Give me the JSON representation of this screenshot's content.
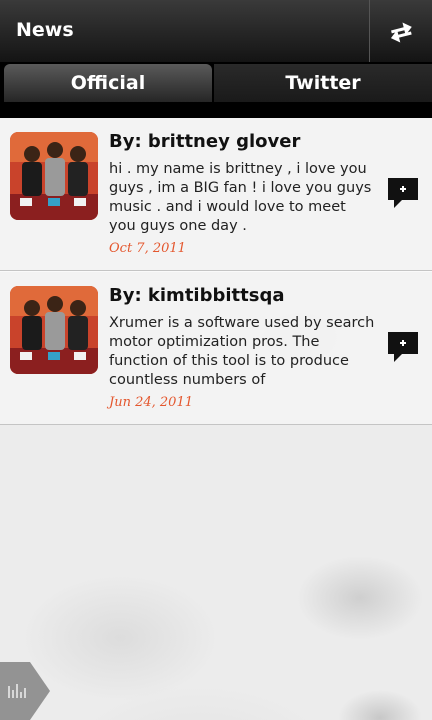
{
  "header": {
    "title": "News"
  },
  "tabs": [
    {
      "label": "Official",
      "active": true
    },
    {
      "label": "Twitter",
      "active": false
    }
  ],
  "posts": [
    {
      "author": "By: brittney glover",
      "text": "hi . my name is brittney , i love you guys , im a BIG fan ! i love you guys music . and i would love to meet you guys one day .",
      "date": "Oct 7, 2011"
    },
    {
      "author": "By: kimtibbittsqa",
      "text": "Xrumer is a software used by search motor optimization pros. The function of this tool is to produce countless numbers of",
      "date": "Jun 24, 2011"
    }
  ],
  "icons": {
    "refresh": "refresh-icon",
    "comment": "add-comment-icon",
    "equalizer": "equalizer-icon"
  },
  "colors": {
    "date": "#e4572e",
    "header": "#1e1e1e"
  }
}
